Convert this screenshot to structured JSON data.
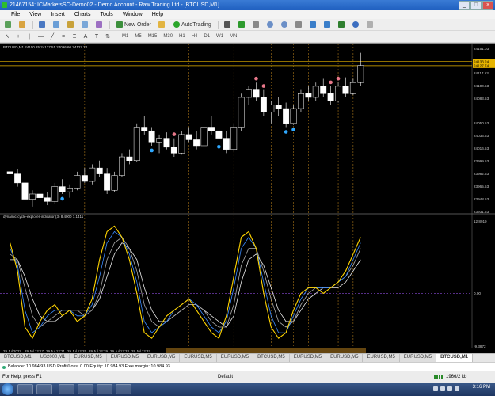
{
  "window": {
    "title": "21467154: ICMarketsSC-Demo02 - Demo Account - Raw Trading Ltd - [BTCUSD,M1]",
    "controls": [
      "_",
      "□",
      "×"
    ]
  },
  "menu": [
    "File",
    "View",
    "Insert",
    "Charts",
    "Tools",
    "Window",
    "Help"
  ],
  "toolbar": {
    "new_order": "New Order",
    "autotrading": "AutoTrading",
    "timeframes": [
      "M1",
      "M5",
      "M15",
      "M30",
      "H1",
      "H4",
      "D1",
      "W1",
      "MN"
    ]
  },
  "chart": {
    "info": "BTCUSD,M1  24100.25 24137.51 24096.60 24127.74",
    "indicator_info": "dynamic-cycle-explorer-indicator (3) 8.4000 7.1411"
  },
  "tabs": [
    "BTCUSD,M1",
    "US2000,M1",
    "EURUSD,M5",
    "EURUSD,M5",
    "EURUSD,M5",
    "EURUSD,M5",
    "EURUSD,M5",
    "BTCUSD,M5",
    "EURUSD,M5",
    "EURUSD,M5",
    "EURUSD,M5",
    "EURUSD,M5",
    "BTCUSD,M1"
  ],
  "active_tab": 12,
  "balance": "Balance: 10 984.93 USD  Profit/Loss: 0.00  Equity: 10 984.93  Free margin: 10 984.93",
  "status": {
    "help": "For Help, press F1",
    "profile": "Default",
    "connection": "1966/2 kb"
  },
  "clock": "3:16 PM",
  "chart_data": {
    "type": "candlestick",
    "price_axis": [
      "24151.03",
      "24133.24",
      "24127.74",
      "24117.53",
      "24100.53",
      "24083.53",
      "24050.53",
      "24033.53",
      "24016.53",
      "23999.53",
      "23982.53",
      "23965.53",
      "23948.53",
      "23931.53"
    ],
    "highlight_prices": [
      "24133.24",
      "24127.74"
    ],
    "ylim": [
      23931.53,
      24151.03
    ],
    "time_axis": [
      "29 Jul 2022",
      "29 Jul 12:17",
      "29 Jul 12:21",
      "29 Jul 12:25",
      "29 Jul 12:29",
      "29 Jul 12:33",
      "29 Jul 12:37"
    ],
    "candles": [
      {
        "o": 23985,
        "h": 23990,
        "l": 23975,
        "c": 23982
      },
      {
        "o": 23982,
        "h": 23988,
        "l": 23965,
        "c": 23970
      },
      {
        "o": 23970,
        "h": 23985,
        "l": 23940,
        "c": 23948
      },
      {
        "o": 23948,
        "h": 23960,
        "l": 23938,
        "c": 23955
      },
      {
        "o": 23955,
        "h": 23962,
        "l": 23945,
        "c": 23950
      },
      {
        "o": 23950,
        "h": 23958,
        "l": 23940,
        "c": 23945
      },
      {
        "o": 23945,
        "h": 23970,
        "l": 23942,
        "c": 23965
      },
      {
        "o": 23965,
        "h": 23975,
        "l": 23955,
        "c": 23958
      },
      {
        "o": 23958,
        "h": 23968,
        "l": 23950,
        "c": 23962
      },
      {
        "o": 23962,
        "h": 23985,
        "l": 23960,
        "c": 23980
      },
      {
        "o": 23980,
        "h": 23990,
        "l": 23970,
        "c": 23972
      },
      {
        "o": 23972,
        "h": 23995,
        "l": 23968,
        "c": 23990
      },
      {
        "o": 23990,
        "h": 24000,
        "l": 23978,
        "c": 23982
      },
      {
        "o": 23982,
        "h": 23990,
        "l": 23955,
        "c": 23960
      },
      {
        "o": 23960,
        "h": 23985,
        "l": 23958,
        "c": 23980
      },
      {
        "o": 23980,
        "h": 24010,
        "l": 23978,
        "c": 24005
      },
      {
        "o": 24005,
        "h": 24015,
        "l": 23995,
        "c": 24000
      },
      {
        "o": 24000,
        "h": 24050,
        "l": 23998,
        "c": 24045
      },
      {
        "o": 24045,
        "h": 24060,
        "l": 24035,
        "c": 24040
      },
      {
        "o": 24040,
        "h": 24045,
        "l": 24020,
        "c": 24025
      },
      {
        "o": 24025,
        "h": 24035,
        "l": 24010,
        "c": 24030
      },
      {
        "o": 24030,
        "h": 24038,
        "l": 24015,
        "c": 24018
      },
      {
        "o": 24018,
        "h": 24030,
        "l": 24005,
        "c": 24010
      },
      {
        "o": 24010,
        "h": 24040,
        "l": 24008,
        "c": 24035
      },
      {
        "o": 24035,
        "h": 24045,
        "l": 24025,
        "c": 24028
      },
      {
        "o": 24028,
        "h": 24040,
        "l": 24015,
        "c": 24020
      },
      {
        "o": 24020,
        "h": 24050,
        "l": 24018,
        "c": 24045
      },
      {
        "o": 24045,
        "h": 24060,
        "l": 24035,
        "c": 24040
      },
      {
        "o": 24040,
        "h": 24048,
        "l": 24025,
        "c": 24030
      },
      {
        "o": 24030,
        "h": 24040,
        "l": 24010,
        "c": 24015
      },
      {
        "o": 24015,
        "h": 24050,
        "l": 24012,
        "c": 24045
      },
      {
        "o": 24045,
        "h": 24090,
        "l": 24040,
        "c": 24085
      },
      {
        "o": 24085,
        "h": 24100,
        "l": 24075,
        "c": 24095
      },
      {
        "o": 24095,
        "h": 24105,
        "l": 24080,
        "c": 24085
      },
      {
        "o": 24085,
        "h": 24095,
        "l": 24060,
        "c": 24065
      },
      {
        "o": 24065,
        "h": 24080,
        "l": 24050,
        "c": 24075
      },
      {
        "o": 24075,
        "h": 24085,
        "l": 24060,
        "c": 24070
      },
      {
        "o": 24070,
        "h": 24078,
        "l": 24045,
        "c": 24050
      },
      {
        "o": 24050,
        "h": 24075,
        "l": 24048,
        "c": 24070
      },
      {
        "o": 24070,
        "h": 24095,
        "l": 24065,
        "c": 24090
      },
      {
        "o": 24090,
        "h": 24100,
        "l": 24080,
        "c": 24085
      },
      {
        "o": 24085,
        "h": 24105,
        "l": 24080,
        "c": 24100
      },
      {
        "o": 24100,
        "h": 24110,
        "l": 24085,
        "c": 24090
      },
      {
        "o": 24090,
        "h": 24100,
        "l": 24075,
        "c": 24080
      },
      {
        "o": 24080,
        "h": 24105,
        "l": 24078,
        "c": 24100
      },
      {
        "o": 24100,
        "h": 24112,
        "l": 24085,
        "c": 24090
      },
      {
        "o": 24090,
        "h": 24110,
        "l": 24088,
        "c": 24105
      },
      {
        "o": 24105,
        "h": 24145,
        "l": 24100,
        "c": 24128
      }
    ],
    "signals_up": [
      7,
      19,
      28,
      37,
      38
    ],
    "signals_down": [
      22,
      33,
      34,
      43,
      44
    ],
    "indicator": {
      "ylim": [
        -9.3872,
        12.8919
      ],
      "labels": [
        "12.8919",
        "0.00",
        "-9.3872"
      ],
      "series": [
        {
          "color": "#ffd400",
          "values": [
            9,
            4,
            -6,
            -8,
            -5,
            -3,
            -2,
            -4,
            -3,
            -5,
            -4,
            -1,
            6,
            11,
            12,
            10,
            6,
            0,
            -7,
            -8,
            -6,
            -4,
            -3,
            -2,
            -1,
            -3,
            -5,
            -7,
            -8,
            -4,
            3,
            10,
            11,
            8,
            0,
            -6,
            -8,
            -7,
            -3,
            0,
            1,
            1,
            0,
            1,
            2,
            4,
            7,
            10
          ]
        },
        {
          "color": "#3b8cff",
          "values": [
            8,
            5,
            -3,
            -7,
            -6,
            -4,
            -3,
            -3,
            -3,
            -4,
            -4,
            -2,
            3,
            9,
            11,
            10,
            7,
            2,
            -5,
            -7,
            -6,
            -5,
            -3,
            -2,
            -1,
            -2,
            -4,
            -6,
            -7,
            -5,
            1,
            8,
            10,
            8,
            2,
            -4,
            -7,
            -7,
            -4,
            -1,
            1,
            1,
            1,
            1,
            2,
            3,
            6,
            9
          ]
        },
        {
          "color": "#aaaaaa",
          "values": [
            7,
            6,
            1,
            -4,
            -6,
            -5,
            -4,
            -3,
            -3,
            -3,
            -4,
            -3,
            0,
            6,
            9,
            10,
            8,
            4,
            -2,
            -5,
            -6,
            -5,
            -4,
            -3,
            -2,
            -2,
            -3,
            -5,
            -6,
            -6,
            -2,
            5,
            8,
            8,
            4,
            -1,
            -5,
            -6,
            -5,
            -2,
            0,
            1,
            1,
            1,
            2,
            3,
            5,
            8
          ]
        },
        {
          "color": "#e8e8e8",
          "values": [
            6,
            6,
            3,
            -1,
            -4,
            -5,
            -5,
            -4,
            -3,
            -3,
            -3,
            -3,
            -1,
            3,
            7,
            9,
            8,
            6,
            1,
            -3,
            -5,
            -5,
            -4,
            -3,
            -2,
            -2,
            -3,
            -4,
            -5,
            -6,
            -4,
            2,
            6,
            7,
            5,
            1,
            -3,
            -5,
            -5,
            -3,
            -1,
            0,
            1,
            1,
            1,
            2,
            4,
            6
          ]
        }
      ]
    }
  }
}
